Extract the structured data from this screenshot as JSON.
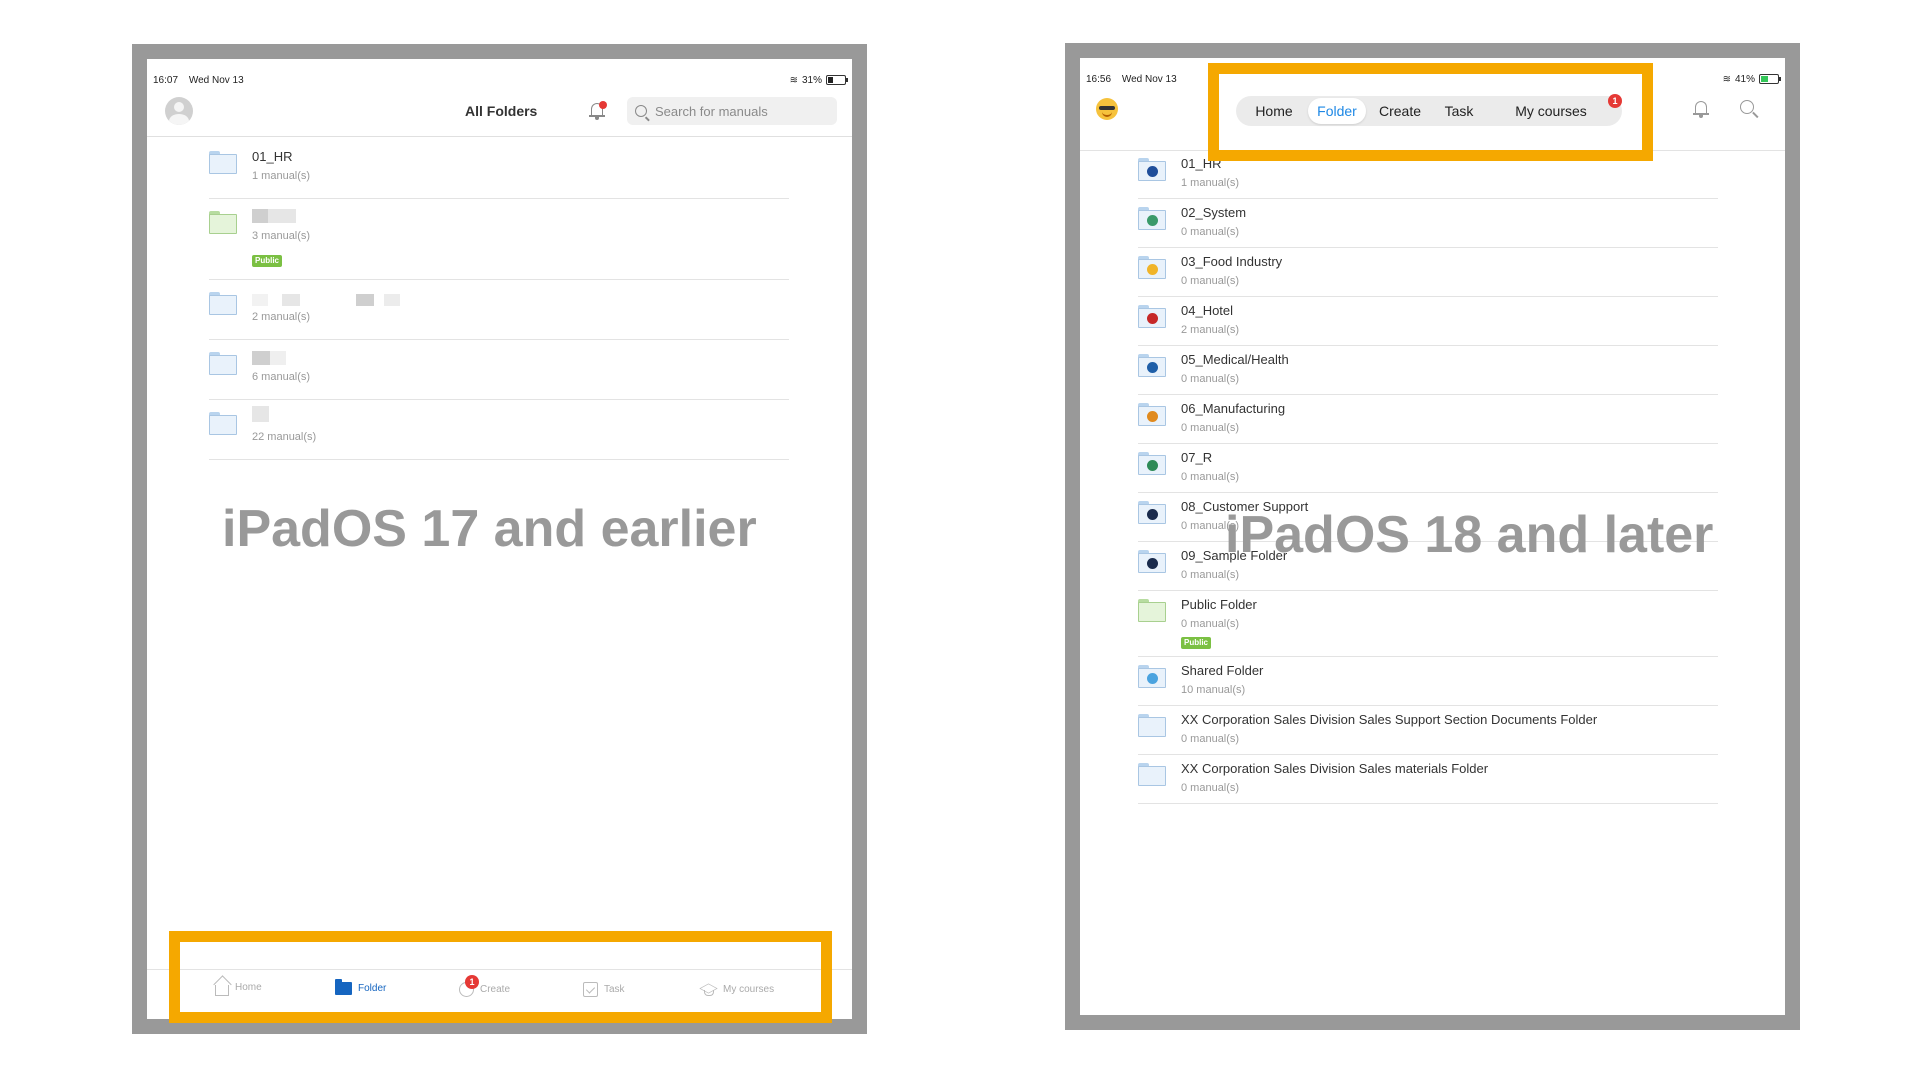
{
  "left": {
    "status": {
      "time": "16:07",
      "date": "Wed Nov 13",
      "battery": "31%",
      "battery_level": 0.31
    },
    "header": {
      "title": "All Folders",
      "search_placeholder": "Search for manuals"
    },
    "folders": [
      {
        "name": "01_HR",
        "count": "1 manual(s)"
      },
      {
        "name": "",
        "count": "3 manual(s)",
        "badge": "Public"
      },
      {
        "name": "",
        "count": "2 manual(s)"
      },
      {
        "name": "",
        "count": "6 manual(s)"
      },
      {
        "name": "",
        "count": "22 manual(s)"
      }
    ],
    "os_label": "iPadOS 17 and earlier",
    "tabbar": {
      "items": [
        {
          "label": "Home",
          "icon": "home-icon"
        },
        {
          "label": "Folder",
          "icon": "folder-icon",
          "active": true
        },
        {
          "label": "Create",
          "icon": "create-icon",
          "badge": "1"
        },
        {
          "label": "Task",
          "icon": "task-icon"
        },
        {
          "label": "My courses",
          "icon": "courses-icon"
        }
      ]
    }
  },
  "right": {
    "status": {
      "time": "16:56",
      "date": "Wed Nov 13",
      "battery": "41%",
      "battery_level": 0.41
    },
    "nav": {
      "items": [
        {
          "label": "Home"
        },
        {
          "label": "Folder",
          "active": true
        },
        {
          "label": "Create"
        },
        {
          "label": "Task"
        },
        {
          "label": "My courses",
          "badge": "1"
        }
      ]
    },
    "folders": [
      {
        "name": "01_HR",
        "count": "1 manual(s)",
        "icon_color": "#1f4e9a"
      },
      {
        "name": "02_System",
        "count": "0 manual(s)",
        "icon_color": "#3a9a6a"
      },
      {
        "name": "03_Food Industry",
        "count": "0 manual(s)",
        "icon_color": "#f0b429"
      },
      {
        "name": "04_Hotel",
        "count": "2 manual(s)",
        "icon_color": "#c62828"
      },
      {
        "name": "05_Medical/Health",
        "count": "0 manual(s)",
        "icon_color": "#1f5fa8"
      },
      {
        "name": "06_Manufacturing",
        "count": "0 manual(s)",
        "icon_color": "#e08a1e"
      },
      {
        "name": "07_R",
        "count": "0 manual(s)",
        "icon_color": "#2e8b57"
      },
      {
        "name": "08_Customer Support",
        "count": "0 manual(s)",
        "icon_color": "#1a2b4c"
      },
      {
        "name": "09_Sample Folder",
        "count": "0 manual(s)",
        "icon_color": "#1a2b4c"
      },
      {
        "name": "Public Folder",
        "count": "0 manual(s)",
        "badge": "Public",
        "green": true
      },
      {
        "name": "Shared Folder",
        "count": "10 manual(s)",
        "icon_color": "#4aa3df"
      },
      {
        "name": "XX Corporation Sales Division Sales Support Section Documents Folder",
        "count": "0 manual(s)"
      },
      {
        "name": "XX Corporation Sales Division Sales materials  Folder",
        "count": "0 manual(s)"
      }
    ],
    "os_label": "iPadOS 18 and later"
  },
  "colors": {
    "highlight": "#f5a800",
    "frame": "#999999",
    "accent": "#1e88e5",
    "public_badge": "#7bc043",
    "badge_red": "#e53935"
  }
}
